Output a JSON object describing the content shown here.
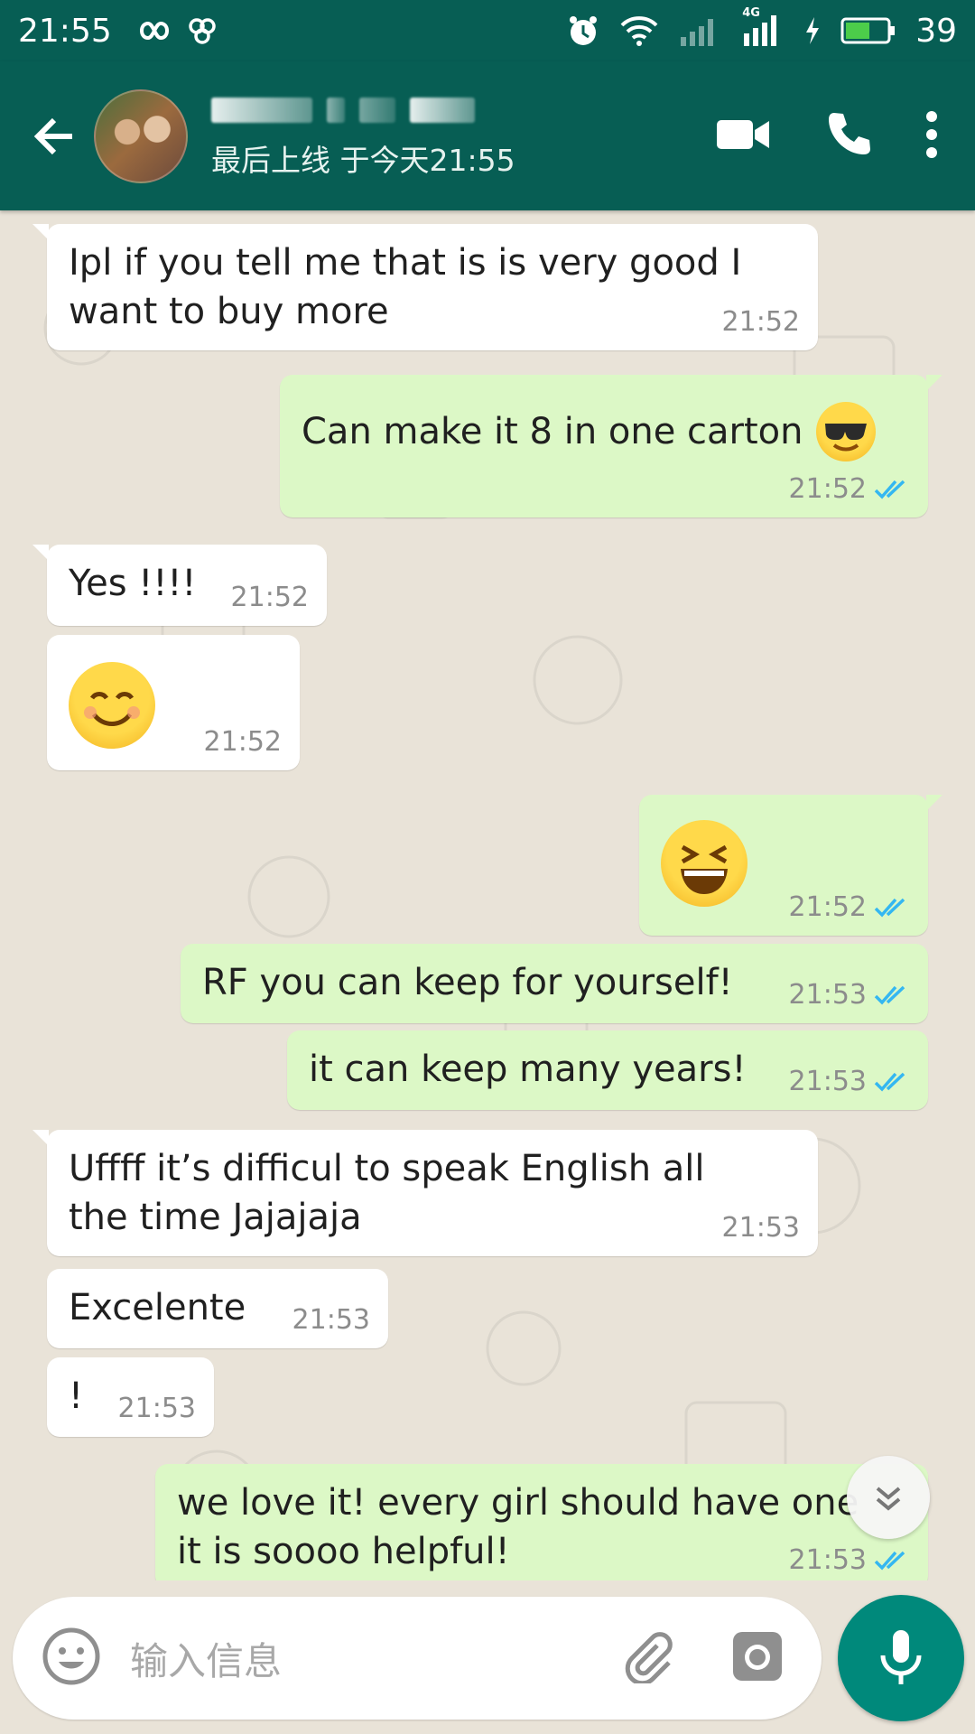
{
  "status_bar": {
    "time": "21:55",
    "battery": "39",
    "network_label": "4G"
  },
  "header": {
    "last_seen": "最后上线 于今天21:55"
  },
  "messages": [
    {
      "dir": "in",
      "text_lines": [
        "Ipl if you tell me that is is very good I",
        "want to buy more"
      ],
      "time": "21:52"
    },
    {
      "dir": "out",
      "text": "Can make it 8 in one carton",
      "emoji": "smiling-face-with-sunglasses",
      "time": "21:52"
    },
    {
      "dir": "in",
      "text": "Yes !!!!",
      "time": "21:52"
    },
    {
      "dir": "in",
      "emoji": "smiling-face-with-smiling-eyes",
      "time": "21:52"
    },
    {
      "dir": "out",
      "emoji": "grinning-squinting-face",
      "time": "21:52"
    },
    {
      "dir": "out",
      "text": "RF you can keep for yourself!",
      "time": "21:53"
    },
    {
      "dir": "out",
      "text": "it can keep many years!",
      "time": "21:53"
    },
    {
      "dir": "in",
      "text_lines": [
        "Uffff it’s difficul to speak English all",
        "the time Jajajaja"
      ],
      "time": "21:53"
    },
    {
      "dir": "in",
      "text": "Excelente",
      "time": "21:53"
    },
    {
      "dir": "in",
      "text": "!",
      "time": "21:53"
    },
    {
      "dir": "out",
      "text_lines": [
        "we love it! every girl should have one",
        "it is soooo helpful!"
      ],
      "time": "21:53"
    }
  ],
  "composer": {
    "placeholder": "输入信息"
  },
  "colors": {
    "header": "#075e54",
    "incoming_bubble": "#ffffff",
    "outgoing_bubble": "#dcf8c6",
    "read_ticks": "#34b7f1",
    "mic_button": "#00897b",
    "chat_background": "#e9e3d8"
  },
  "icons": [
    "back-arrow-icon",
    "video-call-icon",
    "voice-call-icon",
    "more-options-icon",
    "emoji-icon",
    "attach-icon",
    "camera-icon",
    "mic-icon",
    "scroll-down-icon",
    "double-check-icon"
  ]
}
